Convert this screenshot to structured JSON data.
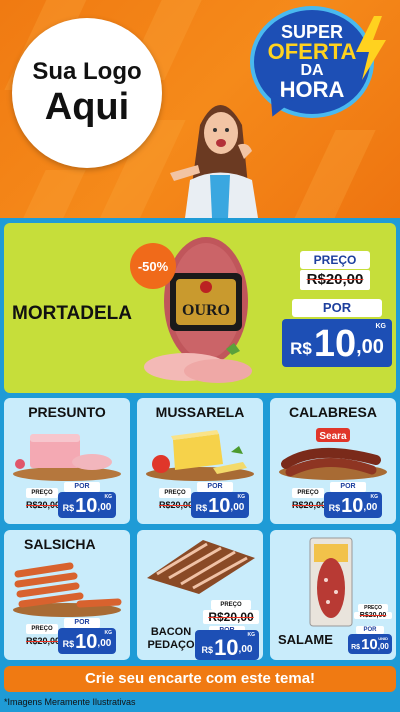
{
  "header": {
    "logo_line1": "Sua Logo",
    "logo_line2": "Aqui",
    "badge": {
      "line1": "SUPER",
      "line2": "OFERTA",
      "line3": "DA",
      "line4": "HORA"
    }
  },
  "featured": {
    "name": "MORTADELA",
    "discount": "-50%",
    "brand_text": "OURO",
    "preco_label": "PREÇO",
    "old_price": "R$20,00",
    "por_label": "POR",
    "currency": "R$",
    "new_int": "10",
    "new_dec": ",00",
    "unit": "KG"
  },
  "products": [
    {
      "name": "PRESUNTO",
      "preco_label": "PREÇO",
      "old_price": "R$20,00",
      "por_label": "POR",
      "currency": "R$",
      "new_int": "10",
      "new_dec": ",00",
      "unit": "KG"
    },
    {
      "name": "MUSSARELA",
      "preco_label": "PREÇO",
      "old_price": "R$20,00",
      "por_label": "POR",
      "currency": "R$",
      "new_int": "10",
      "new_dec": ",00",
      "unit": "KG"
    },
    {
      "name": "CALABRESA",
      "brand_text": "Seara",
      "preco_label": "PREÇO",
      "old_price": "R$20,00",
      "por_label": "POR",
      "currency": "R$",
      "new_int": "10",
      "new_dec": ",00",
      "unit": "KG"
    },
    {
      "name": "SALSICHA",
      "preco_label": "PREÇO",
      "old_price": "R$20,00",
      "por_label": "POR",
      "currency": "R$",
      "new_int": "10",
      "new_dec": ",00",
      "unit": "KG"
    },
    {
      "name_line1": "BACON",
      "name_line2": "PEDAÇO",
      "preco_label": "PREÇO",
      "old_price": "R$20,00",
      "por_label": "POR",
      "currency": "R$",
      "new_int": "10",
      "new_dec": ",00",
      "unit": "KG"
    },
    {
      "name": "SALAME",
      "preco_label": "PREÇO",
      "old_price": "R$20,00",
      "por_label": "POR",
      "currency": "R$",
      "new_int": "10",
      "new_dec": ",00",
      "unit": "UNID"
    }
  ],
  "cta": "Crie seu encarte com este tema!",
  "disclaimer": "*Imagens Meramente Ilustrativas",
  "colors": {
    "orange": "#f07a12",
    "blue": "#1d4fb5",
    "lime": "#c6de3a",
    "light_blue": "#c9ecfb",
    "sky": "#1f9bd6"
  }
}
